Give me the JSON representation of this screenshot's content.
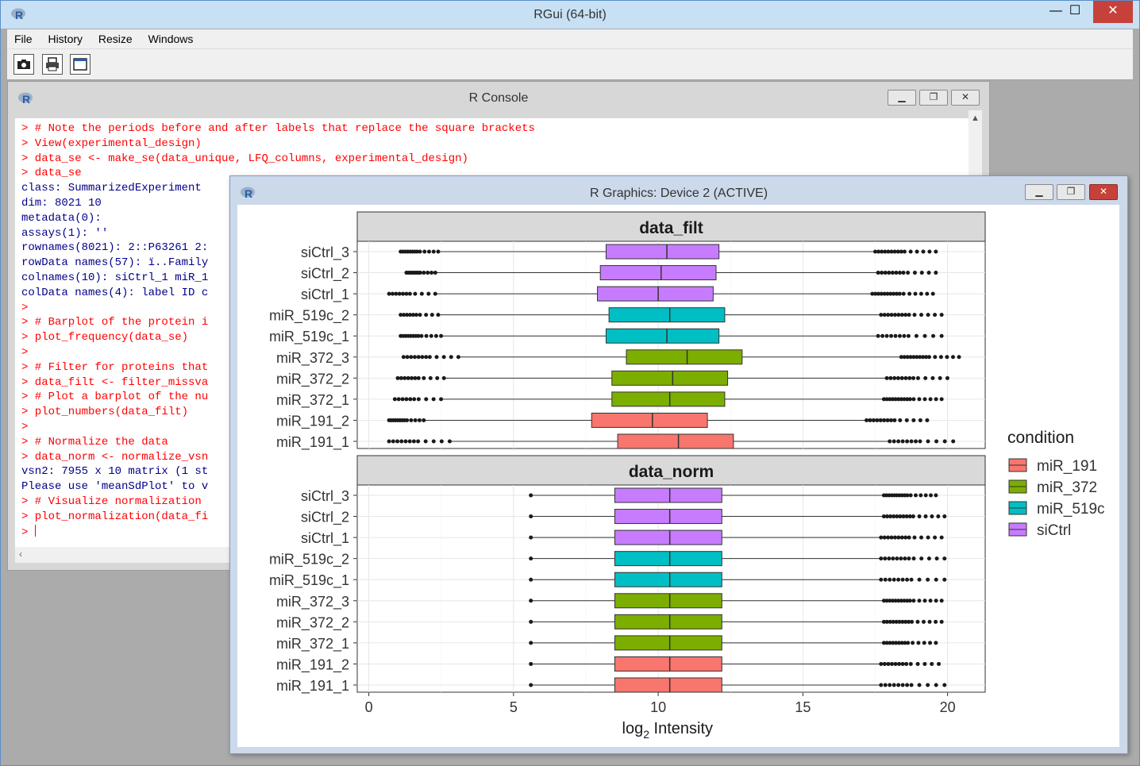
{
  "app": {
    "title": "RGui (64-bit)",
    "minimize": "—",
    "maximize": "☐",
    "close": "✕"
  },
  "menubar": {
    "items": [
      "File",
      "History",
      "Resize",
      "Windows"
    ]
  },
  "toolbar": {
    "buttons": [
      "camera-icon",
      "printer-icon",
      "window-icon"
    ]
  },
  "console": {
    "title": "R Console",
    "lines": [
      {
        "text": "> # Note the periods before and after labels that replace the square brackets",
        "color": "red"
      },
      {
        "text": "> View(experimental_design)",
        "color": "red"
      },
      {
        "text": "> data_se <- make_se(data_unique, LFQ_columns, experimental_design)",
        "color": "red"
      },
      {
        "text": "> data_se",
        "color": "red"
      },
      {
        "text": "class: SummarizedExperiment",
        "color": "blue"
      },
      {
        "text": "dim: 8021 10",
        "color": "blue"
      },
      {
        "text": "metadata(0):",
        "color": "blue"
      },
      {
        "text": "assays(1): ''",
        "color": "blue"
      },
      {
        "text": "rownames(8021): 2::P63261 2:",
        "color": "blue"
      },
      {
        "text": "rowData names(57): ï..Family",
        "color": "blue"
      },
      {
        "text": "colnames(10): siCtrl_1 miR_1",
        "color": "blue"
      },
      {
        "text": "colData names(4): label ID c",
        "color": "blue"
      },
      {
        "text": ">",
        "color": "red"
      },
      {
        "text": "> # Barplot of the protein i",
        "color": "red"
      },
      {
        "text": "> plot_frequency(data_se)",
        "color": "red"
      },
      {
        "text": ">",
        "color": "red"
      },
      {
        "text": "> # Filter for proteins that",
        "color": "red"
      },
      {
        "text": "> data_filt <- filter_missva",
        "color": "red"
      },
      {
        "text": "> # Plot a barplot of the nu",
        "color": "red"
      },
      {
        "text": "> plot_numbers(data_filt)",
        "color": "red"
      },
      {
        "text": ">",
        "color": "red"
      },
      {
        "text": "> # Normalize the data",
        "color": "red"
      },
      {
        "text": "> data_norm <- normalize_vsn",
        "color": "red"
      },
      {
        "text": "vsn2: 7955 x 10 matrix (1 st",
        "color": "blue"
      },
      {
        "text": "Please use 'meanSdPlot' to v",
        "color": "blue"
      },
      {
        "text": "> # Visualize normalization",
        "color": "red"
      },
      {
        "text": "> plot_normalization(data_fi",
        "color": "red"
      },
      {
        "text": "> ",
        "color": "red",
        "cursor": true
      }
    ]
  },
  "graphics": {
    "title": "R Graphics: Device 2 (ACTIVE)"
  },
  "chart_data": {
    "type": "boxplot",
    "facets": [
      "data_filt",
      "data_norm"
    ],
    "categories": [
      "siCtrl_3",
      "siCtrl_2",
      "siCtrl_1",
      "miR_519c_2",
      "miR_519c_1",
      "miR_372_3",
      "miR_372_2",
      "miR_372_1",
      "miR_191_2",
      "miR_191_1"
    ],
    "condition_of": [
      "siCtrl",
      "siCtrl",
      "siCtrl",
      "miR_519c",
      "miR_519c",
      "miR_372",
      "miR_372",
      "miR_372",
      "miR_191",
      "miR_191"
    ],
    "xlabel_main": "log",
    "xlabel_sub": "2",
    "xlabel_rest": " Intensity",
    "xlim": [
      -0.4,
      21.3
    ],
    "x_ticks": [
      0,
      5,
      10,
      15,
      20
    ],
    "grid": true,
    "legend": {
      "title": "condition",
      "position": "right",
      "items": [
        {
          "name": "miR_191",
          "color": "#F8766D"
        },
        {
          "name": "miR_372",
          "color": "#7CAE00"
        },
        {
          "name": "miR_519c",
          "color": "#00BFC4"
        },
        {
          "name": "siCtrl",
          "color": "#C77CFF"
        }
      ]
    },
    "series": {
      "data_filt": [
        {
          "q1": 8.2,
          "median": 10.3,
          "q3": 12.1,
          "lo_out": [
            1.1,
            2.4
          ],
          "hi_out": [
            17.5,
            19.6
          ]
        },
        {
          "q1": 8.0,
          "median": 10.1,
          "q3": 12.0,
          "lo_out": [
            1.3,
            2.3
          ],
          "hi_out": [
            17.6,
            19.6
          ]
        },
        {
          "q1": 7.9,
          "median": 10.0,
          "q3": 11.9,
          "lo_out": [
            0.7,
            2.3
          ],
          "hi_out": [
            17.4,
            19.5
          ]
        },
        {
          "q1": 8.3,
          "median": 10.4,
          "q3": 12.3,
          "lo_out": [
            1.1,
            2.4
          ],
          "hi_out": [
            17.7,
            19.8
          ]
        },
        {
          "q1": 8.2,
          "median": 10.3,
          "q3": 12.1,
          "lo_out": [
            1.1,
            2.5
          ],
          "hi_out": [
            17.6,
            19.8
          ]
        },
        {
          "q1": 8.9,
          "median": 11.0,
          "q3": 12.9,
          "lo_out": [
            1.2,
            3.1
          ],
          "hi_out": [
            18.4,
            20.4
          ]
        },
        {
          "q1": 8.4,
          "median": 10.5,
          "q3": 12.4,
          "lo_out": [
            1.0,
            2.6
          ],
          "hi_out": [
            17.9,
            20.0
          ]
        },
        {
          "q1": 8.4,
          "median": 10.4,
          "q3": 12.3,
          "lo_out": [
            0.9,
            2.5
          ],
          "hi_out": [
            17.8,
            19.8
          ]
        },
        {
          "q1": 7.7,
          "median": 9.8,
          "q3": 11.7,
          "lo_out": [
            0.7,
            1.9
          ],
          "hi_out": [
            17.2,
            19.3
          ]
        },
        {
          "q1": 8.6,
          "median": 10.7,
          "q3": 12.6,
          "lo_out": [
            0.7,
            2.8
          ],
          "hi_out": [
            18.0,
            20.2
          ]
        }
      ],
      "data_norm": [
        {
          "q1": 8.5,
          "median": 10.4,
          "q3": 12.2,
          "lo_out": [
            5.6,
            5.6
          ],
          "hi_out": [
            17.8,
            19.6
          ]
        },
        {
          "q1": 8.5,
          "median": 10.4,
          "q3": 12.2,
          "lo_out": [
            5.6,
            5.6
          ],
          "hi_out": [
            17.8,
            19.9
          ]
        },
        {
          "q1": 8.5,
          "median": 10.4,
          "q3": 12.2,
          "lo_out": [
            5.6,
            5.6
          ],
          "hi_out": [
            17.7,
            19.8
          ]
        },
        {
          "q1": 8.5,
          "median": 10.4,
          "q3": 12.2,
          "lo_out": [
            5.6,
            5.6
          ],
          "hi_out": [
            17.7,
            19.9
          ]
        },
        {
          "q1": 8.5,
          "median": 10.4,
          "q3": 12.2,
          "lo_out": [
            5.6,
            5.6
          ],
          "hi_out": [
            17.7,
            19.9
          ]
        },
        {
          "q1": 8.5,
          "median": 10.4,
          "q3": 12.2,
          "lo_out": [
            5.6,
            5.6
          ],
          "hi_out": [
            17.8,
            19.8
          ]
        },
        {
          "q1": 8.5,
          "median": 10.4,
          "q3": 12.2,
          "lo_out": [
            5.6,
            5.6
          ],
          "hi_out": [
            17.8,
            19.8
          ]
        },
        {
          "q1": 8.5,
          "median": 10.4,
          "q3": 12.2,
          "lo_out": [
            5.6,
            5.6
          ],
          "hi_out": [
            17.8,
            19.6
          ]
        },
        {
          "q1": 8.5,
          "median": 10.4,
          "q3": 12.2,
          "lo_out": [
            5.6,
            5.6
          ],
          "hi_out": [
            17.7,
            19.7
          ]
        },
        {
          "q1": 8.5,
          "median": 10.4,
          "q3": 12.2,
          "lo_out": [
            5.6,
            5.6
          ],
          "hi_out": [
            17.7,
            19.9
          ]
        }
      ]
    }
  }
}
